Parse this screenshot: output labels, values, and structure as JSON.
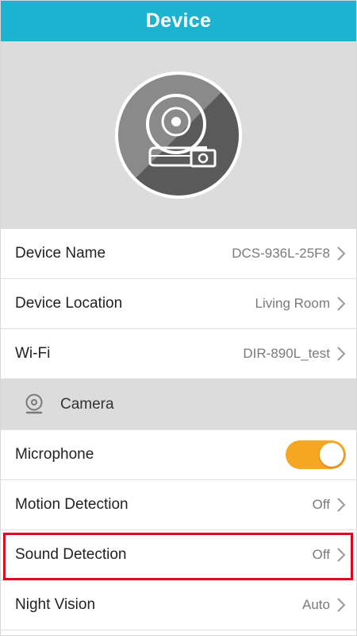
{
  "header": {
    "title": "Device"
  },
  "device_image": {
    "icon": "camera-device-icon"
  },
  "settings": {
    "device_name": {
      "label": "Device Name",
      "value": "DCS-936L-25F8"
    },
    "device_location": {
      "label": "Device Location",
      "value": "Living Room"
    },
    "wifi": {
      "label": "Wi-Fi",
      "value": "DIR-890L_test"
    }
  },
  "camera_section": {
    "label": "Camera",
    "microphone": {
      "label": "Microphone",
      "enabled": true
    },
    "motion_detection": {
      "label": "Motion Detection",
      "value": "Off"
    },
    "sound_detection": {
      "label": "Sound Detection",
      "value": "Off"
    },
    "night_vision": {
      "label": "Night Vision",
      "value": "Auto"
    }
  },
  "colors": {
    "header": "#1bb3cf",
    "toggle_on": "#f5a623",
    "highlight": "#e4001b"
  }
}
